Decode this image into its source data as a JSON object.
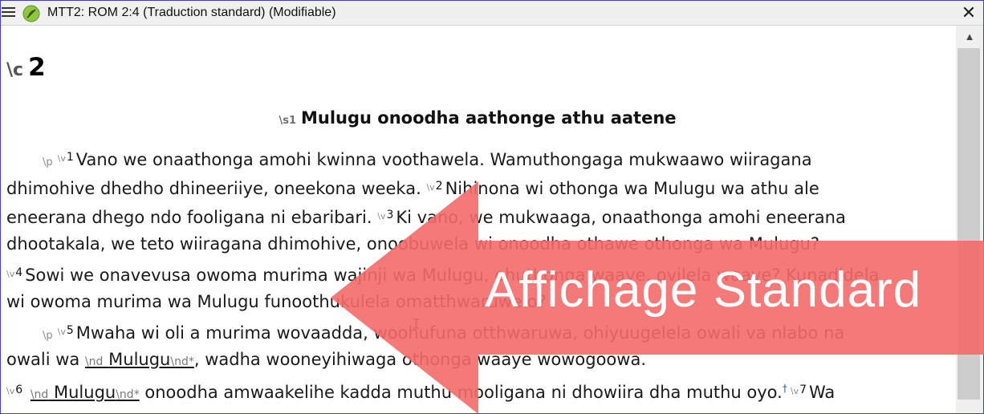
{
  "window": {
    "title": "MTT2: ROM 2:4 (Traduction standard) (Modifiable)",
    "close_glyph": "✕",
    "scroll_up_glyph": "▲"
  },
  "icons": {
    "menu": "hamburger-menu-icon",
    "leaf": "leaf-icon",
    "close": "close-icon"
  },
  "colors": {
    "accent_leaf": "#8fc640",
    "frame_border": "#3b3fc4",
    "overlay": "#f36b6b"
  },
  "content": {
    "chapter_marker": "\\c",
    "chapter_number": "2",
    "heading_marker": "\\s1",
    "heading_text": "Mulugu onoodha aathonge athu aatene",
    "p_marker": "\\p",
    "v_marker": "\\v",
    "nd_open": "\\nd",
    "nd_close": "\\nd*",
    "dagger": "†",
    "lines": [
      {
        "v": "1",
        "text": "Vano we onaathonga amohi kwinna voothawela. Wamuthongaga mukwaawo wiiragana"
      },
      {
        "text": "dhimohive dhedho dhineeriiye, oneekona weeka.",
        "v2": "2",
        "text2": "Nihinona wi othonga wa Mulugu wa athu ale"
      },
      {
        "text": "eneerana dhego ndo fooligana ni ebaribari.",
        "v2": "3",
        "text2": "Ki vano, we mukwaaga, onaathonga amohi eneerana"
      },
      {
        "text": "dhootakala, we teto wiiragana dhimohive, onoobuwela wi onoodha othawe othonga wa Mulugu?"
      },
      {
        "v": "4",
        "text": "Sowi we onavevusa owoma murima wajinji wa Mulugu, ohuthonga waaye, ovilela waaye? Kunadidela"
      },
      {
        "text": "wi owoma murima wa Mulugu funoothukulela omatthwaruwelo?"
      },
      {
        "v": "5",
        "text": "Mwaha wi oli a murima wovaadda, woohufuna otthwaruwa, ohiyuugelela owali va nlabo na"
      },
      {
        "text_pre": "owali wa",
        "nd_word": "Mulugu",
        "text_post": ", wadha wooneyihiwaga othonga waaye wowogoowa."
      },
      {
        "v": "6",
        "nd_word": "Mulugu",
        "text_post": " onoodha amwaakelihe kadda muthu mooligana ni dhowiira dha muthu oyo.",
        "v2": "7",
        "text2": "Wa"
      }
    ]
  },
  "overlay": {
    "label": "Affichage Standard"
  }
}
